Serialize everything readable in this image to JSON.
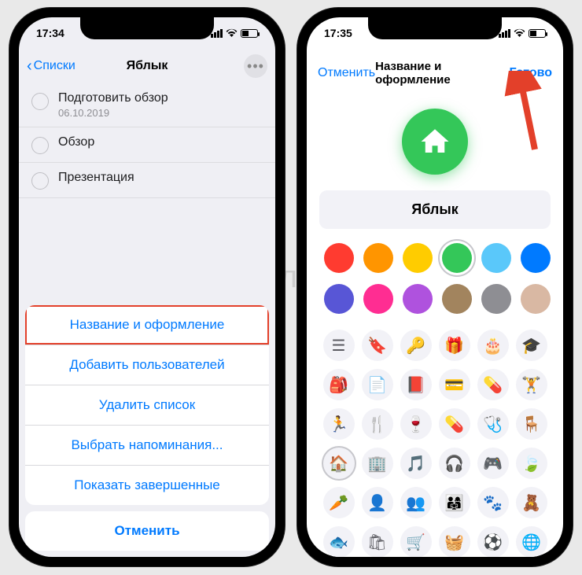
{
  "watermark": "я́блык",
  "left": {
    "status_time": "17:34",
    "back_label": "Списки",
    "title": "Яблык",
    "reminders": [
      {
        "text": "Подготовить обзор",
        "sub": "06.10.2019"
      },
      {
        "text": "Обзор",
        "sub": ""
      },
      {
        "text": "Презентация",
        "sub": ""
      }
    ],
    "sheet": {
      "options": [
        "Название и оформление",
        "Добавить пользователей",
        "Удалить список",
        "Выбрать напоминания...",
        "Показать завершенные"
      ],
      "highlighted_index": 0,
      "cancel": "Отменить"
    }
  },
  "right": {
    "status_time": "17:35",
    "cancel": "Отменить",
    "title": "Название и оформление",
    "done": "Готово",
    "list_name": "Яблык",
    "preview_icon": "house",
    "colors": [
      {
        "hex": "#ff3b30"
      },
      {
        "hex": "#ff9500"
      },
      {
        "hex": "#ffcc00"
      },
      {
        "hex": "#34c759",
        "selected": true
      },
      {
        "hex": "#5ac8fa"
      },
      {
        "hex": "#007aff"
      },
      {
        "hex": "#5856d6"
      },
      {
        "hex": "#ff2d92"
      },
      {
        "hex": "#af52de"
      },
      {
        "hex": "#a2845e"
      },
      {
        "hex": "#8e8e93"
      },
      {
        "hex": "#d9b8a3"
      }
    ],
    "icons": [
      {
        "name": "list-bullet-icon",
        "glyph": "☰"
      },
      {
        "name": "bookmark-icon",
        "glyph": "🔖"
      },
      {
        "name": "key-icon",
        "glyph": "🔑"
      },
      {
        "name": "gift-icon",
        "glyph": "🎁"
      },
      {
        "name": "cake-icon",
        "glyph": "🎂"
      },
      {
        "name": "graduation-cap-icon",
        "glyph": "🎓"
      },
      {
        "name": "backpack-icon",
        "glyph": "🎒"
      },
      {
        "name": "document-icon",
        "glyph": "📄"
      },
      {
        "name": "book-icon",
        "glyph": "📕"
      },
      {
        "name": "credit-card-icon",
        "glyph": "💳"
      },
      {
        "name": "pills-circle-icon",
        "glyph": "💊"
      },
      {
        "name": "dumbbell-icon",
        "glyph": "🏋"
      },
      {
        "name": "running-icon",
        "glyph": "🏃"
      },
      {
        "name": "fork-knife-icon",
        "glyph": "🍴"
      },
      {
        "name": "wine-glass-icon",
        "glyph": "🍷"
      },
      {
        "name": "pills-icon",
        "glyph": "💊"
      },
      {
        "name": "stethoscope-icon",
        "glyph": "🩺"
      },
      {
        "name": "chair-icon",
        "glyph": "🪑"
      },
      {
        "name": "house-icon",
        "glyph": "🏠",
        "selected": true
      },
      {
        "name": "building-icon",
        "glyph": "🏢"
      },
      {
        "name": "music-icon",
        "glyph": "🎵"
      },
      {
        "name": "headphones-icon",
        "glyph": "🎧"
      },
      {
        "name": "game-controller-icon",
        "glyph": "🎮"
      },
      {
        "name": "leaf-icon",
        "glyph": "🍃"
      },
      {
        "name": "carrot-icon",
        "glyph": "🥕"
      },
      {
        "name": "person-icon",
        "glyph": "👤"
      },
      {
        "name": "people-icon",
        "glyph": "👥"
      },
      {
        "name": "family-icon",
        "glyph": "👨‍👩‍👧"
      },
      {
        "name": "paw-icon",
        "glyph": "🐾"
      },
      {
        "name": "teddy-bear-icon",
        "glyph": "🧸"
      },
      {
        "name": "fish-icon",
        "glyph": "🐟"
      },
      {
        "name": "shopping-bag-icon",
        "glyph": "🛍"
      },
      {
        "name": "cart-icon",
        "glyph": "🛒"
      },
      {
        "name": "basket-icon",
        "glyph": "🧺"
      },
      {
        "name": "soccer-ball-icon",
        "glyph": "⚽"
      },
      {
        "name": "globe-icon",
        "glyph": "🌐"
      }
    ]
  }
}
